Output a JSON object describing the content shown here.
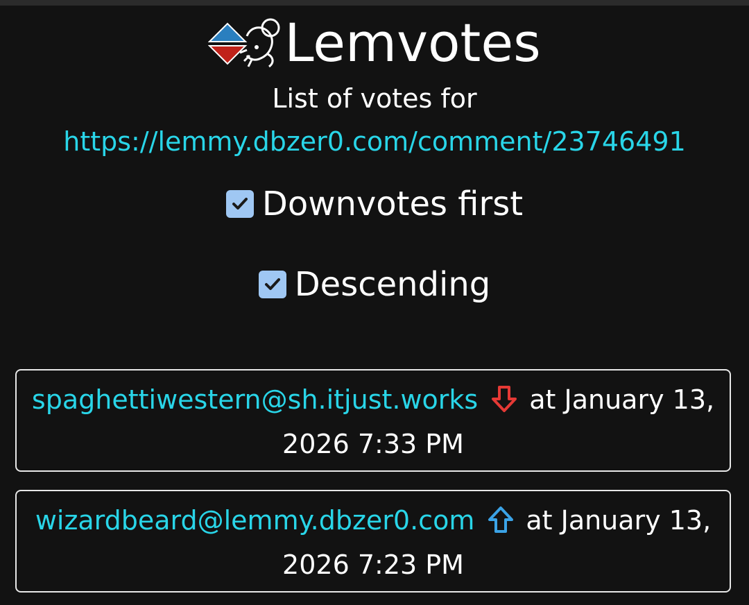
{
  "app": {
    "title": "Lemvotes"
  },
  "header": {
    "subtitle": "List of votes for",
    "link": "https://lemmy.dbzer0.com/comment/23746491"
  },
  "options": [
    {
      "label": "Downvotes first",
      "checked": true
    },
    {
      "label": "Descending",
      "checked": true
    }
  ],
  "votes": [
    {
      "user": "spaghettiwestern@sh.itjust.works",
      "vote": "downvote",
      "icon": "arrow-down-icon",
      "color": "#e53935",
      "time_prefix": "at January 13,",
      "time_suffix": "2026 7:33 PM"
    },
    {
      "user": "wizardbeard@lemmy.dbzer0.com",
      "vote": "upvote",
      "icon": "arrow-up-icon",
      "color": "#3ba3e6",
      "time_prefix": "at January 13,",
      "time_suffix": "2026 7:23 PM"
    }
  ],
  "colors": {
    "background": "#121212",
    "link": "#29d5e8",
    "checkbox": "#9fc7f3"
  }
}
